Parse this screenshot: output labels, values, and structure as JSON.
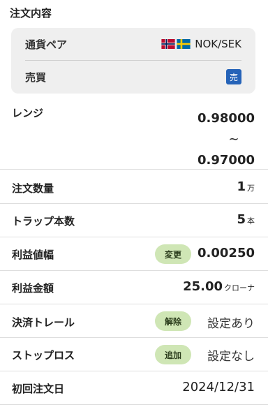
{
  "section_title": "注文内容",
  "pair": {
    "label": "通貨ペア",
    "value": "NOK/SEK",
    "flags": [
      "norway-flag-icon",
      "sweden-flag-icon"
    ]
  },
  "side": {
    "label": "売買",
    "badge": "売",
    "badge_color": "#2563b8"
  },
  "range": {
    "label": "レンジ",
    "high": "0.98000",
    "tilde": "~",
    "low": "0.97000"
  },
  "quantity": {
    "label": "注文数量",
    "value": "1",
    "unit": "万"
  },
  "traps": {
    "label": "トラップ本数",
    "value": "5",
    "unit": "本"
  },
  "profit_width": {
    "label": "利益値幅",
    "button": "変更",
    "value": "0.00250"
  },
  "profit_amount": {
    "label": "利益金額",
    "value": "25.00",
    "unit": "クローナ"
  },
  "trail": {
    "label": "決済トレール",
    "button": "解除",
    "value": "設定あり"
  },
  "stoploss": {
    "label": "ストップロス",
    "button": "追加",
    "value": "設定なし"
  },
  "first_date": {
    "label": "初回注文日",
    "value": "2024/12/31"
  },
  "colors": {
    "pill_bg": "#cfe6b5",
    "card_bg": "#efefef"
  }
}
